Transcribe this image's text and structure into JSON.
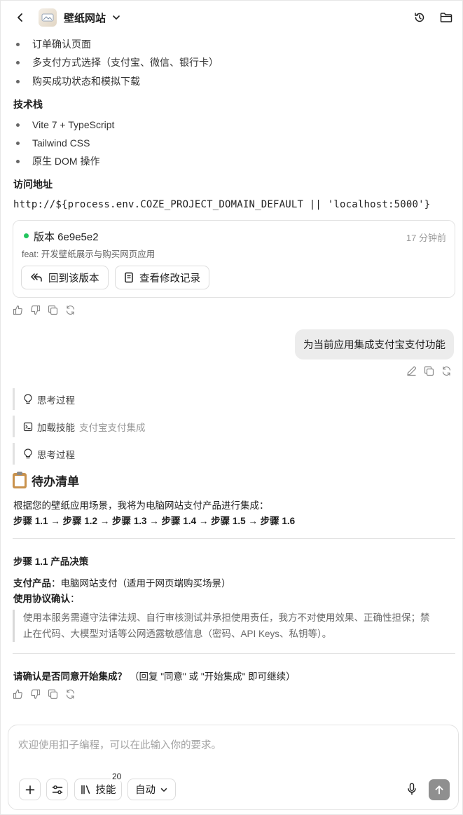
{
  "header": {
    "title": "壁纸网站"
  },
  "features": [
    "订单确认页面",
    "多支付方式选择（支付宝、微信、银行卡）",
    "购买成功状态和模拟下载"
  ],
  "tech_stack": {
    "heading": "技术栈",
    "items": [
      "Vite 7 + TypeScript",
      "Tailwind CSS",
      "原生 DOM 操作"
    ]
  },
  "access": {
    "heading": "访问地址",
    "url": "http://${process.env.COZE_PROJECT_DOMAIN_DEFAULT || 'localhost:5000'}"
  },
  "version_card": {
    "title": "版本 6e9e5e2",
    "time": "17 分钟前",
    "commit": "feat: 开发壁纸展示与购买网页应用",
    "revert_label": "回到该版本",
    "history_label": "查看修改记录",
    "status_color": "#22c55e"
  },
  "user_message": "为当前应用集成支付宝支付功能",
  "steps": {
    "thinking_1": "思考过程",
    "skill_label": "加载技能",
    "skill_name": "支付宝支付集成",
    "thinking_2": "思考过程"
  },
  "todo": {
    "title": "待办清单",
    "intro": "根据您的壁纸应用场景，我将为电脑网站支付产品进行集成：",
    "steps_line": "步骤 1.1 → 步骤 1.2 → 步骤 1.3 → 步骤 1.4 → 步骤 1.5 → 步骤 1.6",
    "section_title": "步骤 1.1 产品决策",
    "product_label": "支付产品",
    "product_value": "：电脑网站支付（适用于网页端购买场景）",
    "agreement_label": "使用协议确认",
    "agreement_colon": "：",
    "agreement_line1": "使用本服务需遵守法律法规、自行审核测试并承担使用责任，我方不对使用效果、正确性担保；禁",
    "agreement_line2": "止在代码、大模型对话等公网透露敏感信息（密码、API Keys、私钥等）。",
    "confirm_question": "请确认是否同意开始集成？",
    "confirm_hint": "（回复 \"同意\" 或 \"开始集成\" 即可继续）"
  },
  "input": {
    "placeholder": "欢迎使用扣子编程，可以在此输入你的要求。",
    "skills_label": "技能",
    "skills_count": "20",
    "mode_label": "自动"
  }
}
